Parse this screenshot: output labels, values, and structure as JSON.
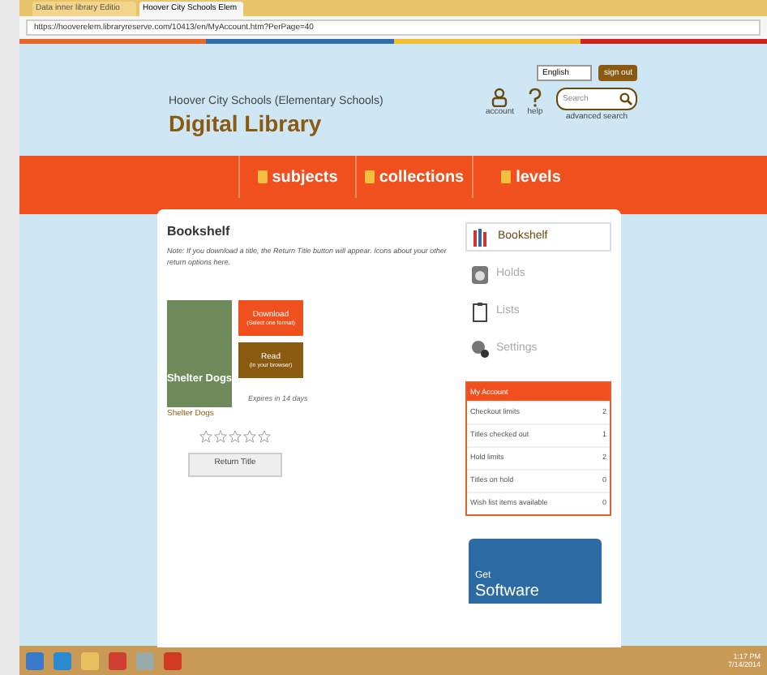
{
  "browser": {
    "tabs": [
      {
        "title": "Data inner library Editio",
        "selected": false
      },
      {
        "title": "Hoover City Schools Elem",
        "selected": true
      }
    ],
    "url": "https://hooverelem.libraryreserve.com/10413/en/MyAccount.htm?PerPage=40"
  },
  "header": {
    "subtitle": "Hoover City Schools (Elementary Schools)",
    "title": "Digital Library",
    "language": "English",
    "sign_out": "sign out",
    "account": "account",
    "help": "help",
    "search": {
      "placeholder": "Search"
    },
    "advanced_search": "advanced search"
  },
  "nav": [
    "subjects",
    "collections",
    "levels"
  ],
  "bookshelf": {
    "heading": "Bookshelf",
    "note": "Note: If you download a title, the Return Title button will appear. Icons about your other return options here.",
    "book": {
      "cover_title": "Shelter Dogs",
      "title": "Shelter Dogs",
      "expires": "Expires in 14 days",
      "stars": 0,
      "download": "Download",
      "download_sub": "(Select one format)",
      "read": "Read",
      "read_sub": "(in your browser)",
      "return": "Return Title"
    }
  },
  "sidebar": [
    {
      "label": "Bookshelf",
      "selected": true
    },
    {
      "label": "Holds",
      "selected": false
    },
    {
      "label": "Lists",
      "selected": false
    },
    {
      "label": "Settings",
      "selected": false
    }
  ],
  "my_account": {
    "title": "My Account",
    "rows": [
      {
        "label": "Checkout limits",
        "value": "2"
      },
      {
        "label": "Titles checked out",
        "value": "1"
      },
      {
        "label": "Hold limits",
        "value": "2"
      },
      {
        "label": "Titles on hold",
        "value": "0"
      },
      {
        "label": "Wish list items available",
        "value": "0"
      }
    ]
  },
  "ad": {
    "line1": "Get",
    "line2": "Software"
  },
  "taskbar": {
    "time": "1:17 PM",
    "date": "7/14/2014"
  }
}
